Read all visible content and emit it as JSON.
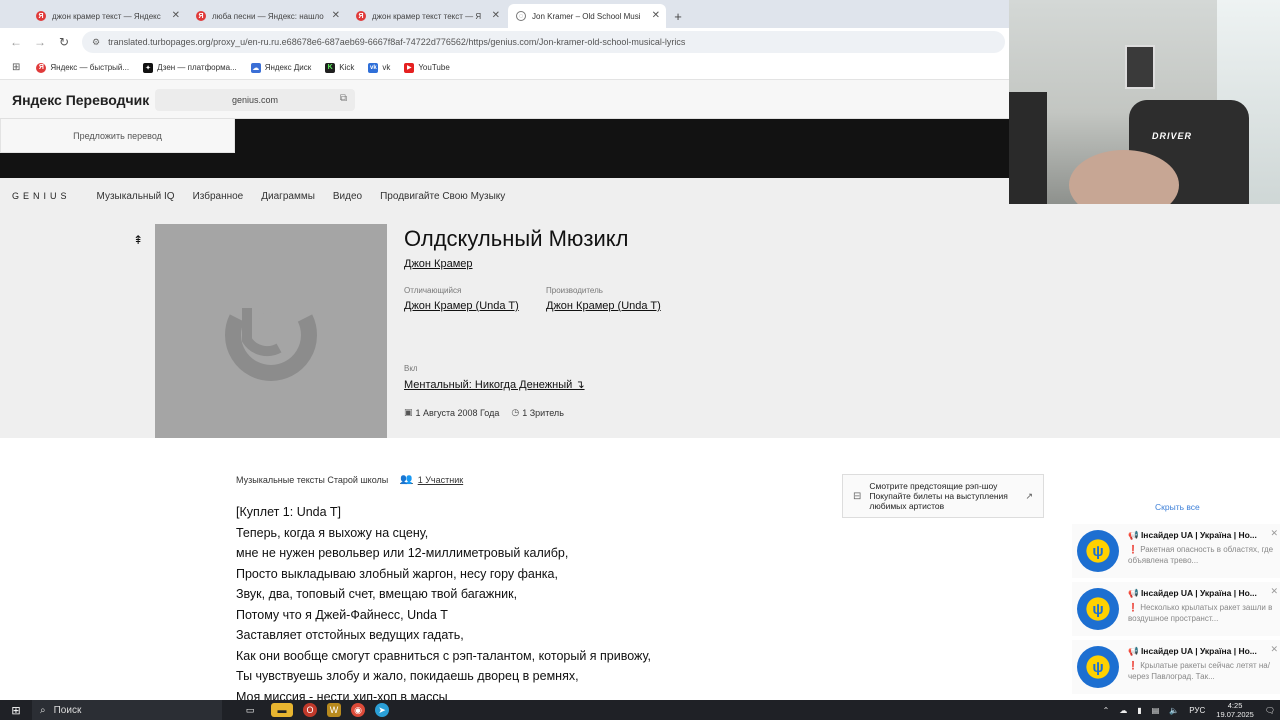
{
  "browser": {
    "tabs": [
      {
        "title": "джон крамер текст — Яндекс",
        "favicon": "yandex-icon",
        "active": false
      },
      {
        "title": "люба песни — Яндекс: нашло",
        "favicon": "yandex-icon",
        "active": false
      },
      {
        "title": "джон крамер текст текст — Я",
        "favicon": "yandex-icon",
        "active": false
      },
      {
        "title": "Jon Kramer – Old School Musi",
        "favicon": "globe-icon",
        "active": true
      }
    ],
    "new_tab": "+",
    "url": "translated.turbopages.org/proxy_u/en-ru.ru.e68678e6-687aeb69-6667f8af-74722d776562/https/genius.com/Jon-kramer-old-school-musical-lyrics",
    "bookmarks": [
      {
        "label": "Яндекс — быстрый...",
        "color": "#e03a3a",
        "glyph": "Я"
      },
      {
        "label": "Дзен — платформа...",
        "color": "#111111",
        "glyph": "✦"
      },
      {
        "label": "Яндекс Диск",
        "color": "#3b6fd6",
        "glyph": "☁"
      },
      {
        "label": "Kick",
        "color": "#1f1f1f",
        "glyph": "K"
      },
      {
        "label": "vk",
        "color": "#2f6fd8",
        "glyph": "vk"
      },
      {
        "label": "YouTube",
        "color": "#e52020",
        "glyph": "▶"
      }
    ]
  },
  "translator": {
    "brand": "Яндекс Переводчик",
    "site": "genius.com",
    "suggest": "Предложить перевод"
  },
  "genius_nav": {
    "logo": "GENIUS",
    "links": [
      "Музыкальный IQ",
      "Избранное",
      "Диаграммы",
      "Видео",
      "Продвигайте Свою Музыку"
    ]
  },
  "song": {
    "title": "Олдскульный Мюзикл",
    "artist": "Джон Крамер",
    "featuring_label": "Отличающийся",
    "featuring": "Джон Крамер (Unda T)",
    "producer_label": "Производитель",
    "producer": "Джон Крамер (Unda T)",
    "album_label": "Вкл",
    "album": "Ментальный: Никогда Денежный ↴",
    "date": "1 Августа 2008 Года",
    "views": "1 Зритель"
  },
  "lyrics": {
    "heading": "Музыкальные тексты Старой школы",
    "contributors": "1 Участник",
    "lines": [
      "[Куплет 1: Unda T]",
      "Теперь, когда я выхожу на сцену,",
      "мне не нужен револьвер или 12-миллиметровый калибр,",
      "Просто выкладываю злобный жаргон, несу гору фанка,",
      "Звук, два, топовый счет, вмещаю твой багажник,",
      "Потому что я Джей-Файнесс, Unda T",
      "Заставляет отстойных ведущих гадать,",
      "Как они вообще смогут сравниться с рэп-талантом, который я привожу,",
      "Ты чувствуешь злобу и жало, покидаешь дворец в ремнях,",
      "Моя миссия - нести хип-хоп в массы"
    ]
  },
  "promo": {
    "line1": "Смотрите предстоящие рэп-шоу",
    "line2": "Покупайте билеты на выступления любимых артистов"
  },
  "notifications": {
    "hide_all": "Скрыть все",
    "items": [
      {
        "title": "📢 Інсайдер UA | Україна | Но...",
        "text": "Ракетная опасность в областях, где объявлена трево..."
      },
      {
        "title": "📢 Інсайдер UA | Україна | Но...",
        "text": "Несколько крылатых ракет зашли в воздушное пространст..."
      },
      {
        "title": "📢 Інсайдер UA | Україна | Но...",
        "text": "Крылатые ракеты сейчас летят на/через Павлоград. Так..."
      }
    ]
  },
  "webcam": {
    "overlay_text": "DRIVER"
  },
  "taskbar": {
    "search_placeholder": "Поиск",
    "language": "РУС",
    "time": "4:25",
    "date": "19.07.2025"
  }
}
